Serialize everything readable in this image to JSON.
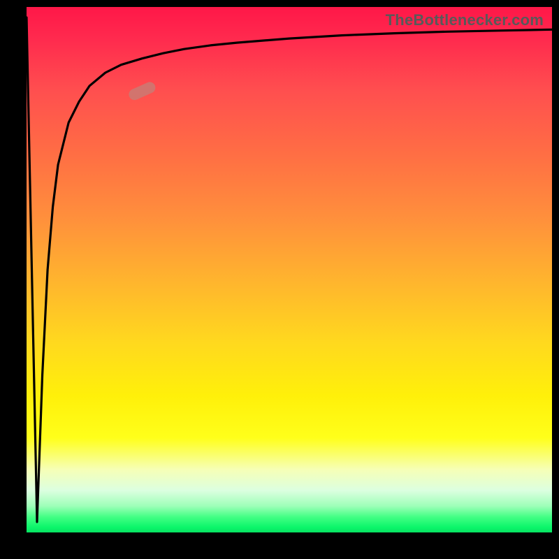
{
  "attribution": "TheBottlenecker.com",
  "chart_data": {
    "type": "line",
    "title": "",
    "xlabel": "",
    "ylabel": "",
    "xlim": [
      0,
      100
    ],
    "ylim": [
      0,
      100
    ],
    "x": [
      0,
      1,
      2,
      3,
      4,
      5,
      6,
      8,
      10,
      12,
      15,
      18,
      22,
      26,
      30,
      35,
      40,
      50,
      60,
      70,
      80,
      90,
      100
    ],
    "values": [
      98,
      50,
      2,
      30,
      50,
      62,
      70,
      78,
      82,
      85,
      87.5,
      89,
      90.2,
      91.2,
      92,
      92.7,
      93.2,
      94,
      94.6,
      95,
      95.3,
      95.5,
      95.7
    ],
    "marker": {
      "x": 22,
      "y": 84,
      "angle_deg": -24
    },
    "gradient_stops": [
      {
        "pos": 0.0,
        "color": "#ff1748"
      },
      {
        "pos": 0.5,
        "color": "#ffb42e"
      },
      {
        "pos": 0.82,
        "color": "#ffff1a"
      },
      {
        "pos": 1.0,
        "color": "#07e362"
      }
    ]
  }
}
